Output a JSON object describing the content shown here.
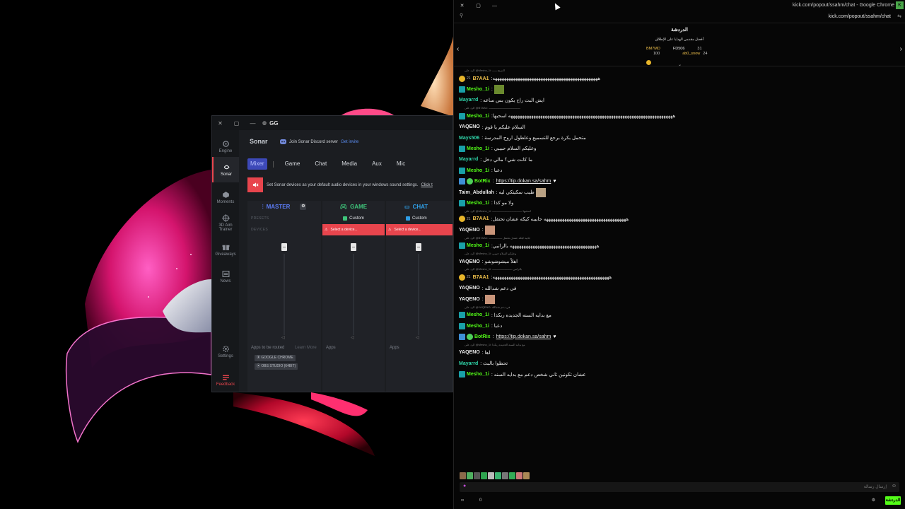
{
  "gg": {
    "title": "GG",
    "titlebar_controls": {
      "close": "✕",
      "restore": "▢",
      "minimize": "—"
    },
    "sidebar": [
      {
        "label": "Engine",
        "icon": "gear-engine-icon"
      },
      {
        "label": "Sonar",
        "icon": "sonar-icon",
        "active": true
      },
      {
        "label": "Moments",
        "icon": "moments-icon"
      },
      {
        "label": "3D Aim Trainer",
        "label2": "Trainer",
        "label1": "3D Aim",
        "icon": "aim-icon"
      },
      {
        "label": "Giveaways",
        "icon": "gift-icon"
      },
      {
        "label": "News",
        "icon": "news-icon"
      },
      {
        "label": "Settings",
        "icon": "settings-icon"
      },
      {
        "label": "Feedback",
        "icon": "feedback-icon"
      }
    ],
    "sonar_title": "Sonar",
    "discord_text": "Join Sonar Discord server",
    "discord_invite": "Get invite",
    "tabs": [
      "Mixer",
      "Game",
      "Chat",
      "Media",
      "Aux",
      "Mic"
    ],
    "warning": "Set Sonar devices as your default audio devices in your windows sound settings.",
    "warning_link": "Click t",
    "master": {
      "label": "MASTER",
      "row_presets": "PRESETS",
      "row_devices": "DEVICES"
    },
    "game": {
      "label": "GAME",
      "preset": "Custom",
      "error": "Select a device..."
    },
    "chat": {
      "label": "CHAT",
      "preset": "Custom",
      "error": "Select a device..."
    },
    "apps_routed_label": "Apps to be routed",
    "learn_more": "Learn More",
    "apps_label": "Apps",
    "apps_routed": [
      "GOOGLE CHROME",
      "OBS STUDIO (64BIT)"
    ],
    "colors": {
      "accent_red": "#e8454d",
      "game_green": "#3ec47a",
      "chat_blue": "#2f9ee6",
      "master_blue": "#4d6cf2"
    }
  },
  "chrome": {
    "title": "kick.com/popout/ssahm/chat - Google Chrome",
    "url": "kick.com/popout/ssahm/chat",
    "controls": {
      "close": "✕",
      "restore": "▢",
      "minimize": "—"
    },
    "chat_title": "الدردشة",
    "leaderboard_title": "أفضل مقدمي الهدايا على الإطلاق",
    "leaderboard": [
      {
        "name": "BM7MD",
        "count": "100",
        "name2": "FD506",
        "count2": "31"
      },
      {
        "name": "",
        "count": "",
        "name2": "ab0_snow",
        "count2": "24"
      }
    ],
    "messages": [
      {
        "reply": "الرد على @Mesho_1i: النبرج ــــــ",
        "user": "B7AA1",
        "color": "#f1c24c",
        "badges": [
          "sub"
        ],
        "pre": "21",
        "text": ":ههههههههههههههههههههههههههههههههههههههههههههههه"
      },
      {
        "user": "Mesho_1i",
        "color": "#53fc18",
        "badges": [
          "mod"
        ],
        "text": ":",
        "emote": "#6b8a2e"
      },
      {
        "user": "Mayarrd",
        "color": "#2fd3a8",
        "badges": [],
        "text": ": ايش البث راح يكون بس ساعه"
      },
      {
        "reply": "الرد على @B7AA1: ــــــــــــــــــــــــــــــــــــــ",
        "user": "Mesho_1i",
        "color": "#53fc18",
        "badges": [
          "mod"
        ],
        "text": ":ههههههههههههههههههههههههههههههههههههههههههههههههههههههههههههههههههههههههه اسحبها"
      },
      {
        "user": "YAQENO",
        "color": "#e9e9e9",
        "badges": [],
        "text": ": السلام عليكم يا قوم"
      },
      {
        "user": "Mays506",
        "color": "#2fd3a8",
        "badges": [],
        "text": ": متحمل بكرة برجع للتسميع وعلطول اروح المدرسة"
      },
      {
        "user": "Mesho_1i",
        "color": "#53fc18",
        "badges": [
          "mod"
        ],
        "text": ": وعليكم السلام حبيبي"
      },
      {
        "user": "Mayarrd",
        "color": "#2fd3a8",
        "badges": [],
        "text": ": ما كانت شي؟ مالي دخل"
      },
      {
        "user": "Mesho_1i",
        "color": "#53fc18",
        "badges": [
          "mod"
        ],
        "text": ": دعبا"
      },
      {
        "user": "BotRix",
        "color": "#53fc18",
        "badges": [
          "bot",
          "v"
        ],
        "text": ":",
        "link": "https://tip.dokan.sa/sahm",
        "heart": "♥"
      },
      {
        "user": "Taim_Abdullah",
        "color": "#e9e9e9",
        "badges": [],
        "text": ": طيب سكيتكي ليه",
        "emote": "#b9a183"
      },
      {
        "user": "Mesho_1i",
        "color": "#53fc18",
        "badges": [
          "mod"
        ],
        "text": ": ولا مو كذا"
      },
      {
        "reply": "الرد على @Mesho_1i: اسحبها ــــــــــــــــــــــــــــــــــــ",
        "user": "B7AA1",
        "color": "#f1c24c",
        "badges": [
          "sub"
        ],
        "pre": "21",
        "text": ":ههههههههههههههههههههههههههههههههههههه جاييبه كيكه عشان تحتفل"
      },
      {
        "user": "YAQENO",
        "color": "#e9e9e9",
        "badges": [],
        "text": ":",
        "emote": "#c9957a"
      },
      {
        "reply": "الرد على @B7AA1: جابيه كيكه عشان تحتفل ــــــــــــــــ",
        "user": "Mesho_1i",
        "color": "#53fc18",
        "badges": [
          "mod"
        ],
        "text": ":ههههههههههههههههههههههههههههههههههههههه بالراتبي"
      },
      {
        "reply": "الرد على @Mesho_1i: وعليكم السلام حبيبي",
        "user": "YAQENO",
        "color": "#e9e9e9",
        "badges": [],
        "text": ": اهلاً ميشوشوشو"
      },
      {
        "reply": "الرد على @Mesho_1i: بالراتبي ــــــــــــــــــــــــ",
        "user": "B7AA1",
        "color": "#f1c24c",
        "badges": [
          "sub"
        ],
        "pre": "21",
        "text": ":هههههههههههههههههههههههههههههههههههههههههههههههههههه"
      },
      {
        "user": "YAQENO",
        "color": "#e9e9e9",
        "badges": [],
        "text": ": في دعم شدالله"
      },
      {
        "user": "YAQENO",
        "color": "#e9e9e9",
        "badges": [],
        "text": ":",
        "emote": "#c9957a"
      },
      {
        "reply": "الرد على @YAQENO: في دعم شدالله",
        "user": "Mesho_1i",
        "color": "#53fc18",
        "badges": [
          "mod"
        ],
        "text": ": مع بدايه السنه الجديده ربكذا"
      },
      {
        "user": "Mesho_1i",
        "color": "#53fc18",
        "badges": [
          "mod"
        ],
        "text": ": دعبا"
      },
      {
        "user": "BotRix",
        "color": "#53fc18",
        "badges": [
          "bot",
          "v"
        ],
        "text": ":",
        "link": "https://tip.dokan.sa/sahm",
        "heart": "♥"
      },
      {
        "reply": "الرد على @Mesho_1i: مع بدايه السنه الجديده ربكذا",
        "user": "YAQENO",
        "color": "#e9e9e9",
        "badges": [],
        "text": ": اها"
      },
      {
        "user": "Mayarrd",
        "color": "#2fd3a8",
        "badges": [],
        "text": ": تحظوا بالبث"
      },
      {
        "user": "Mesho_1i",
        "color": "#53fc18",
        "badges": [
          "mod"
        ],
        "text": ": عشان تكونين ثاني شخص دعم مع بدايه السنه"
      }
    ],
    "input_placeholder": "إرسال رسالة",
    "send_label": "الدردشة",
    "bottom_left1": "∞",
    "bottom_left2": "0"
  }
}
